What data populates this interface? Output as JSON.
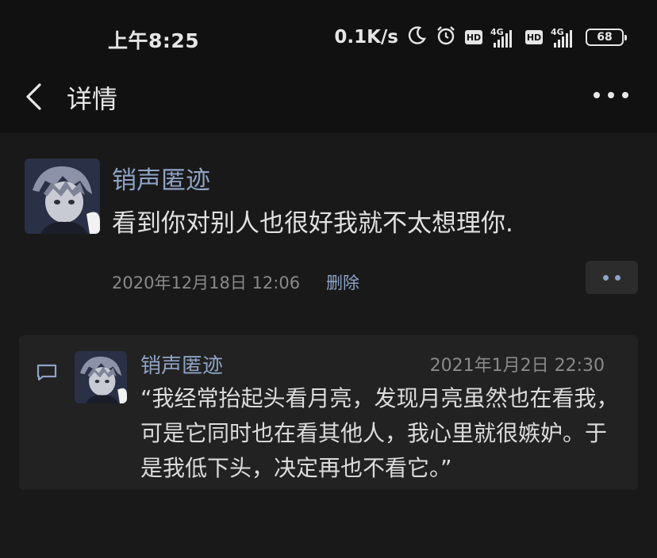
{
  "status_bar": {
    "time": "上午8:25",
    "net_speed": "0.1K/s",
    "hd_label": "HD",
    "network_type": "4G",
    "battery": "68"
  },
  "header": {
    "title": "详情",
    "back_icon": "chevron-left-icon",
    "more_icon": "more-horizontal-icon"
  },
  "post": {
    "author": "销声匿迹",
    "text": "看到你对别人也很好我就不太想理你.",
    "time": "2020年12月18日 12:06",
    "delete_label": "删除",
    "action_icon": "more-dots-icon"
  },
  "comment": {
    "icon": "comment-icon",
    "author": "销声匿迹",
    "time": "2021年1月2日 22:30",
    "text": "“我经常抬起头看月亮，发现月亮虽然也在看我，可是它同时也在看其他人，我心里就很嫉妒。于是我低下头，决定再也不看它。”"
  },
  "colors": {
    "background": "#191919",
    "bar_background": "#111111",
    "accent": "#8fa3c6",
    "card": "#222222"
  }
}
